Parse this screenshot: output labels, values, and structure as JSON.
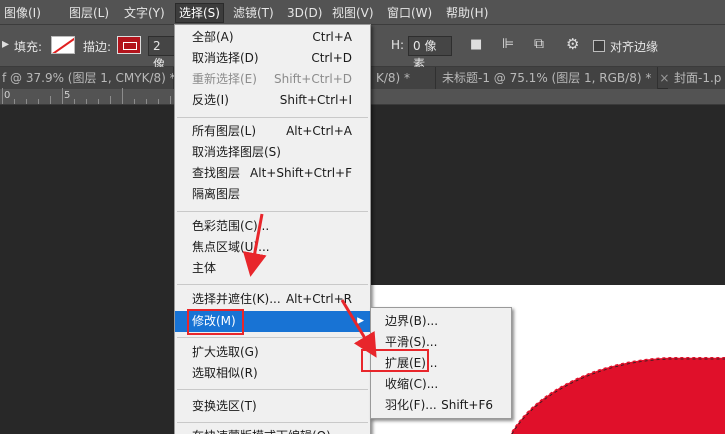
{
  "menubar": {
    "items": [
      "图像(I)",
      "图层(L)",
      "文字(Y)",
      "选择(S)",
      "滤镜(T)",
      "3D(D)",
      "视图(V)",
      "窗口(W)",
      "帮助(H)"
    ]
  },
  "options": {
    "fill_label": "填充:",
    "stroke_label": "描边:",
    "stroke_width": "2 像",
    "h_label": "H:",
    "h_value": "0 像素",
    "align_edges_label": "对齐边缘"
  },
  "tabs": [
    "f @ 37.9% (图层 1, CMYK/8) *",
    "K/8) *",
    "未标题-1 @ 75.1% (图层 1, RGB/8) *",
    "封面-1.p"
  ],
  "ruler": [
    "0",
    "5"
  ],
  "select_menu": {
    "items": [
      {
        "label": "全部(A)",
        "shortcut": "Ctrl+A"
      },
      {
        "label": "取消选择(D)",
        "shortcut": "Ctrl+D"
      },
      {
        "label": "重新选择(E)",
        "shortcut": "Shift+Ctrl+D"
      },
      {
        "label": "反选(I)",
        "shortcut": "Shift+Ctrl+I"
      },
      {
        "label": "所有图层(L)",
        "shortcut": "Alt+Ctrl+A"
      },
      {
        "label": "取消选择图层(S)",
        "shortcut": ""
      },
      {
        "label": "查找图层",
        "shortcut": "Alt+Shift+Ctrl+F"
      },
      {
        "label": "隔离图层",
        "shortcut": ""
      },
      {
        "label": "色彩范围(C)...",
        "shortcut": ""
      },
      {
        "label": "焦点区域(U)...",
        "shortcut": ""
      },
      {
        "label": "主体",
        "shortcut": ""
      },
      {
        "label": "选择并遮住(K)...",
        "shortcut": "Alt+Ctrl+R"
      },
      {
        "label": "修改(M)",
        "shortcut": ""
      },
      {
        "label": "扩大选取(G)",
        "shortcut": ""
      },
      {
        "label": "选取相似(R)",
        "shortcut": ""
      },
      {
        "label": "变换选区(T)",
        "shortcut": ""
      },
      {
        "label": "在快速蒙版模式下编辑(Q)",
        "shortcut": ""
      }
    ]
  },
  "modify_submenu": {
    "items": [
      {
        "label": "边界(B)...",
        "shortcut": ""
      },
      {
        "label": "平滑(S)...",
        "shortcut": ""
      },
      {
        "label": "扩展(E)...",
        "shortcut": ""
      },
      {
        "label": "收缩(C)...",
        "shortcut": ""
      },
      {
        "label": "羽化(F)...",
        "shortcut": "Shift+F6"
      }
    ]
  },
  "colors": {
    "menu_highlight": "#1873d4",
    "annotation_red": "#e8262b",
    "shape_red": "#e0102a"
  }
}
